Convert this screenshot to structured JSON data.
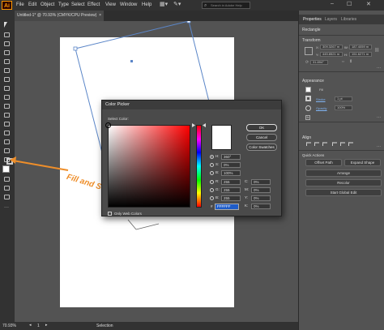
{
  "app": {
    "logo": "Ai"
  },
  "menu": [
    "File",
    "Edit",
    "Object",
    "Type",
    "Select",
    "Effect",
    "View",
    "Window",
    "Help"
  ],
  "search": {
    "placeholder": "Search in Adobe Help"
  },
  "document_tab": {
    "title": "Untitled-1* @ 70.93% (CMYK/CPU Preview)"
  },
  "status": {
    "zoom": "70.93%",
    "page": "1",
    "tool": "Selection"
  },
  "annotation": {
    "text": "Fill and Stroke",
    "color": "#ee8e2a"
  },
  "panel": {
    "tabs": [
      "Properties",
      "Layers",
      "Libraries"
    ],
    "object_type": "Rectangle",
    "transform": {
      "title": "Transform",
      "x": "309.3267 m",
      "y": "445.8521 m",
      "w": "187.4059 m",
      "h": "151.6271 m",
      "angle": "31.894°"
    },
    "appearance": {
      "title": "Appearance",
      "fill_label": "Fill",
      "stroke_label": "Stroke",
      "stroke_value": "1 pt",
      "opacity_label": "Opacity",
      "opacity_value": "100%"
    },
    "align": {
      "title": "Align"
    },
    "quick_actions": {
      "title": "Quick Actions",
      "offset_path": "Offset Path",
      "expand_shape": "Expand Shape",
      "arrange": "Arrange",
      "recolor": "Recolor",
      "global_edit": "Start Global Edit"
    }
  },
  "color_picker": {
    "title": "Color Picker",
    "select_label": "Select Color:",
    "buttons": {
      "ok": "OK",
      "cancel": "Cancel",
      "swatches": "Color Swatches"
    },
    "fields": {
      "h": {
        "label": "H:",
        "value": "360°"
      },
      "s": {
        "label": "S:",
        "value": "0%"
      },
      "b": {
        "label": "B:",
        "value": "100%"
      },
      "r": {
        "label": "R:",
        "value": "255"
      },
      "g": {
        "label": "G:",
        "value": "255"
      },
      "bl": {
        "label": "B:",
        "value": "255"
      },
      "c": {
        "label": "C:",
        "value": "0%"
      },
      "m": {
        "label": "M:",
        "value": "0%"
      },
      "yy": {
        "label": "Y:",
        "value": "0%"
      },
      "k": {
        "label": "K:",
        "value": "0%"
      }
    },
    "hex_prefix": "#",
    "hex": "FFFFFF",
    "web_only": "Only Web Colors",
    "current_color": "#ffffff",
    "hue_position_fraction": 0.0
  }
}
